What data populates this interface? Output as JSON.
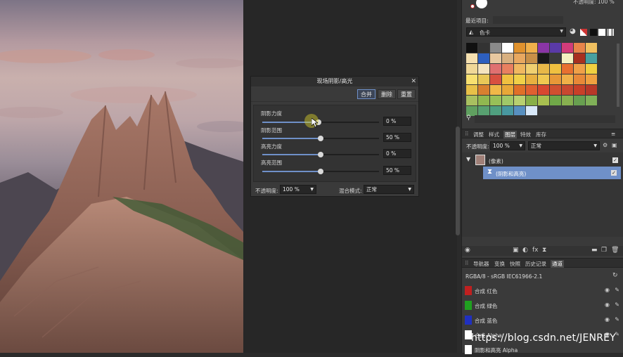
{
  "dialog": {
    "title": "现场阴影/高光",
    "close": "✕",
    "buttons": {
      "merge": "合并",
      "delete": "删除",
      "reset": "重置"
    },
    "sliders": [
      {
        "label": "阴影力度",
        "value_text": "0 %",
        "value": 0.48
      },
      {
        "label": "阴影范围",
        "value_text": "50 %",
        "value": 0.5
      },
      {
        "label": "高亮力度",
        "value_text": "0 %",
        "value": 0.5
      },
      {
        "label": "高亮范围",
        "value_text": "50 %",
        "value": 0.5
      }
    ],
    "opacity_label": "不透明度:",
    "opacity_value": "100 %",
    "blend_label": "混合模式:",
    "blend_value": "正常"
  },
  "panel": {
    "top_opacity": "不透明度: 100 %",
    "recent_label": "最近项目:",
    "palette_name": "色卡",
    "swatches": [
      "#111111",
      "#333333",
      "#8a8a8a",
      "#ffffff",
      "#e0922e",
      "#f0b04a",
      "#8a35a6",
      "#5a3aa8",
      "#d23c7a",
      "#e8844a",
      "#f0c060",
      "#f5e0b0",
      "#2d5fbf",
      "#e8c8a0",
      "#d8b080",
      "#e8a860",
      "#c89048",
      "#1a1a1a",
      "#3a3a3a",
      "#f5f0c0",
      "#a83020",
      "#48a0a0",
      "#f0d898",
      "#f4e4c0",
      "#e07070",
      "#e88060",
      "#f0b860",
      "#f0d070",
      "#e8b848",
      "#f0c040",
      "#e87030",
      "#f0a048",
      "#f0d040",
      "#f8e070",
      "#e8c858",
      "#d85040",
      "#f0c040",
      "#f0d048",
      "#e8b040",
      "#f0c850",
      "#e89838",
      "#f0b048",
      "#e88838",
      "#f0a040",
      "#e8c048",
      "#d88030",
      "#f0b848",
      "#e8a838",
      "#e07028",
      "#e06030",
      "#d84830",
      "#d05030",
      "#c84830",
      "#c84028",
      "#b83828",
      "#a8c060",
      "#90b850",
      "#98c058",
      "#a0c868",
      "#b8d070",
      "#88b048",
      "#a8c050",
      "#70a848",
      "#88b050",
      "#68a050",
      "#80b058",
      "#60a060",
      "#58a070",
      "#50a080",
      "#4898a0",
      "#5890c0",
      "#d8e8f8"
    ],
    "search_icon": "search-icon",
    "tabs1": [
      "调整",
      "样式",
      "图层",
      "特效",
      "库存"
    ],
    "layer_opacity_label": "不透明度:",
    "layer_opacity_value": "100 %",
    "layer_blend_value": "正常",
    "layers": [
      "(像素)",
      "(阴影和高亮)"
    ],
    "tabs2": [
      "导航器",
      "变换",
      "快照",
      "历史记录",
      "通道"
    ],
    "color_profile": "RGBA/8 - sRGB IEC61966-2.1",
    "channels": [
      {
        "name": "合成 红色",
        "color": "#c02020"
      },
      {
        "name": "合成 绿色",
        "color": "#20a020"
      },
      {
        "name": "合成 蓝色",
        "color": "#2030c0"
      },
      {
        "name": "合成 Alpha",
        "color": "#ffffff"
      },
      {
        "name": "阴影和高亮 Alpha",
        "color": "#ffffff"
      }
    ]
  },
  "watermark": "https://blog.csdn.net/JENREY",
  "colors": {
    "accent": "#6f90c8",
    "panel": "#3a3a3a"
  }
}
